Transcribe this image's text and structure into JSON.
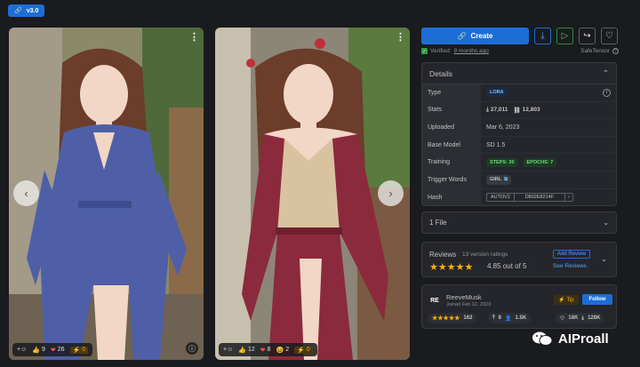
{
  "version_badge": {
    "label": "v3.0",
    "icon": "link-icon"
  },
  "gallery": {
    "images": [
      {
        "reactions": {
          "like": "9",
          "heart": "26",
          "buzz": "0"
        },
        "colors": {
          "bg": "#6b6a4a",
          "dress": "#4e5fa8",
          "hair": "#6b3d2a",
          "skin": "#f2d6c6"
        }
      },
      {
        "reactions": {
          "like": "12",
          "heart": "8",
          "laugh": "2",
          "buzz": "0"
        },
        "colors": {
          "bg": "#7a7464",
          "dress": "#8b2a3c",
          "hair": "#6b3d2a",
          "skin": "#f2d6c6"
        }
      }
    ]
  },
  "actions": {
    "create_label": "Create"
  },
  "verified": {
    "prefix": "Verified:",
    "time": "9 months ago"
  },
  "safetensor_label": "SafeTensor",
  "details": {
    "title": "Details",
    "rows": {
      "type": {
        "label": "Type",
        "value": "LORA"
      },
      "stats": {
        "label": "Stats",
        "downloads": "27,011",
        "generations": "12,803"
      },
      "uploaded": {
        "label": "Uploaded",
        "value": "Mar 6, 2023"
      },
      "base_model": {
        "label": "Base Model",
        "value": "SD 1.5"
      },
      "training": {
        "label": "Training",
        "steps": "STEPS: 30",
        "epochs": "EPOCHS: 7"
      },
      "trigger": {
        "label": "Trigger Words",
        "value": "GIRL"
      },
      "hash": {
        "label": "Hash",
        "algorithm": "AUTOV2",
        "value": "D802E8214F"
      }
    }
  },
  "files": {
    "label": "1 File"
  },
  "reviews": {
    "title": "Reviews",
    "count": "13 version ratings",
    "stars": "★★★★★",
    "average": "4.85 out of 5",
    "add_label": "Add Review",
    "see_label": "See Reviews"
  },
  "creator": {
    "initials": "RE",
    "name": "ReeveMusk",
    "joined": "Joined Feb 12, 2023",
    "tip_label": "Tip",
    "follow_label": "Follow",
    "stars": "★★★★★",
    "rating_count": "162",
    "uploads": "8",
    "followers": "1.5K",
    "favorites": "18K",
    "downloads": "128K"
  },
  "watermark": {
    "text": "AIProall"
  }
}
